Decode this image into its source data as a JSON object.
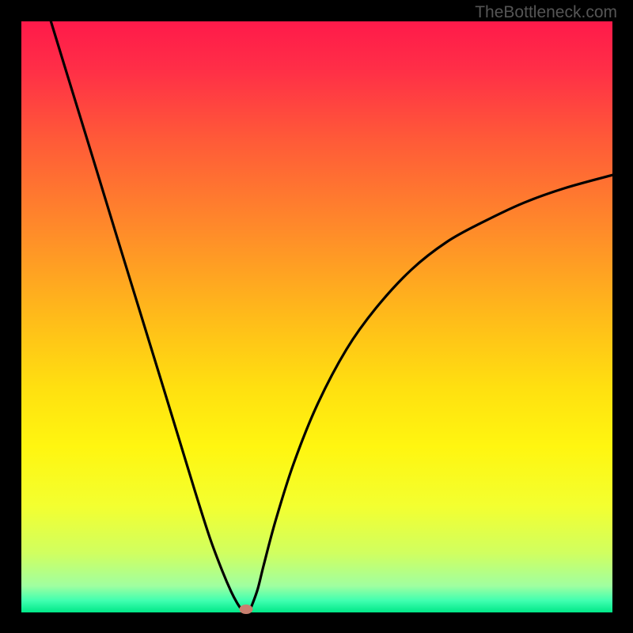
{
  "watermark": "TheBottleneck.com",
  "chart_data": {
    "type": "line",
    "title": "",
    "xlabel": "",
    "ylabel": "",
    "xlim": [
      0,
      100
    ],
    "ylim": [
      0,
      100
    ],
    "x": [
      5,
      8,
      12,
      16,
      20,
      24,
      28,
      30,
      32,
      34,
      35.5,
      36.5,
      37.2,
      37.8,
      38.2,
      38.5,
      39,
      40,
      41,
      43,
      46,
      50,
      55,
      60,
      66,
      72,
      78,
      85,
      92,
      100
    ],
    "y": [
      100,
      90.2,
      77.2,
      64.1,
      51.1,
      38.1,
      25.0,
      18.5,
      12.3,
      7.0,
      3.5,
      1.6,
      0.6,
      0.15,
      0.05,
      0.2,
      1.2,
      4.0,
      8.0,
      15.5,
      25.0,
      35.0,
      44.5,
      51.5,
      58.0,
      62.7,
      66.0,
      69.3,
      71.8,
      74.0
    ],
    "marker": {
      "x": 38.0,
      "y": 0.6,
      "color": "#c97f6f"
    },
    "gradient_stops": [
      {
        "offset": 0.0,
        "color": "#ff1a4a"
      },
      {
        "offset": 0.08,
        "color": "#ff2e47"
      },
      {
        "offset": 0.2,
        "color": "#ff5a38"
      },
      {
        "offset": 0.35,
        "color": "#ff8a2a"
      },
      {
        "offset": 0.5,
        "color": "#ffbb1a"
      },
      {
        "offset": 0.62,
        "color": "#ffe010"
      },
      {
        "offset": 0.72,
        "color": "#fff610"
      },
      {
        "offset": 0.82,
        "color": "#f3ff30"
      },
      {
        "offset": 0.9,
        "color": "#d0ff60"
      },
      {
        "offset": 0.955,
        "color": "#a0ffa0"
      },
      {
        "offset": 0.98,
        "color": "#40ffb0"
      },
      {
        "offset": 1.0,
        "color": "#00e888"
      }
    ]
  }
}
